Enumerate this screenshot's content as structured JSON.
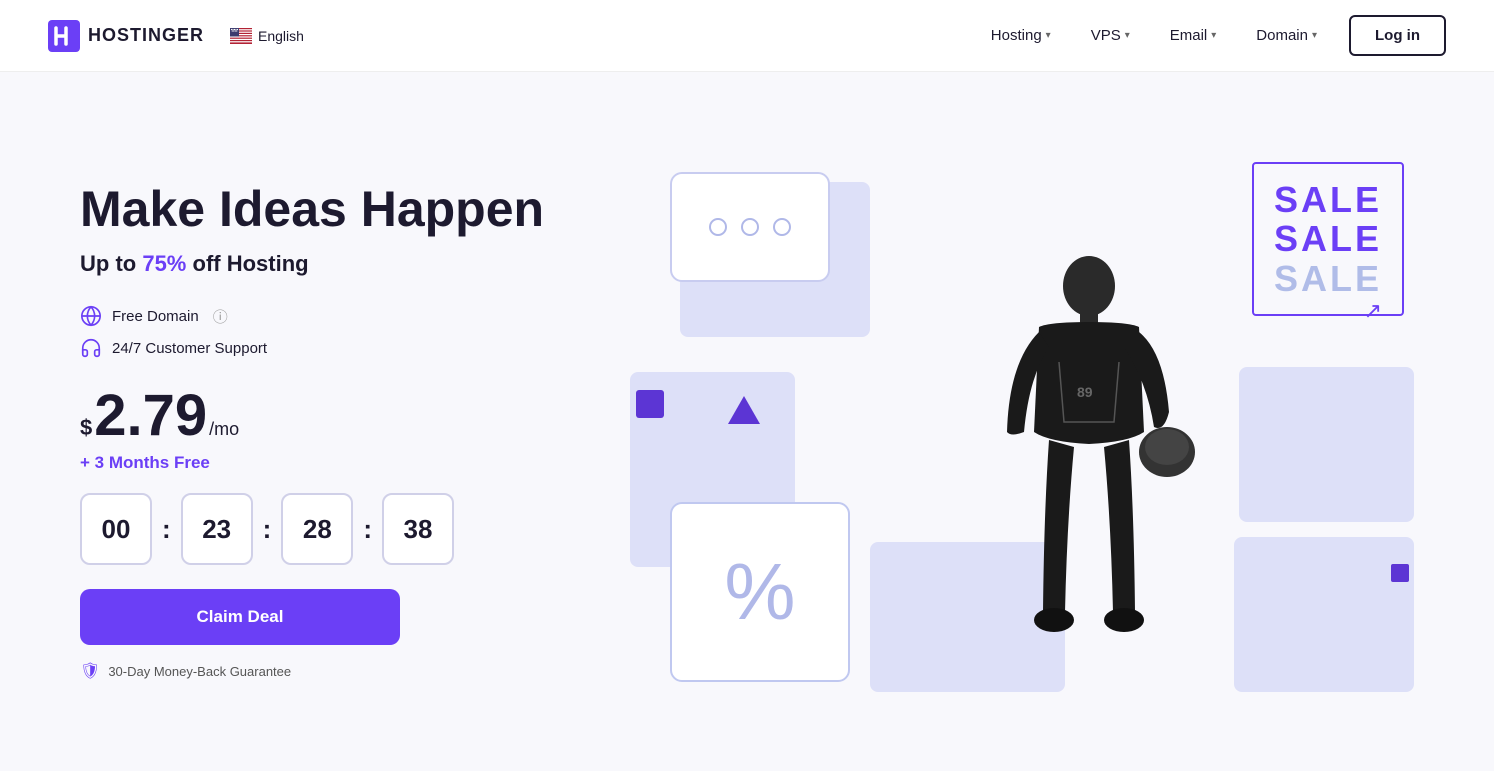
{
  "brand": {
    "name": "HOSTINGER",
    "logo_letter": "H"
  },
  "language": {
    "label": "English",
    "flag_emoji": "🇺🇸"
  },
  "nav": {
    "items": [
      {
        "label": "Hosting",
        "has_dropdown": true
      },
      {
        "label": "VPS",
        "has_dropdown": true
      },
      {
        "label": "Email",
        "has_dropdown": true
      },
      {
        "label": "Domain",
        "has_dropdown": true
      }
    ],
    "login_label": "Log in"
  },
  "hero": {
    "headline": "Make Ideas Happen",
    "subheadline_prefix": "Up to ",
    "discount": "75%",
    "subheadline_suffix": " off Hosting",
    "feature_domain": "Free Domain",
    "feature_support": "24/7 Customer Support",
    "price_dollar": "$",
    "price_main": "2.79",
    "price_mo": "/mo",
    "free_months": "+ 3 Months Free",
    "countdown": {
      "hours": "00",
      "minutes": "23",
      "seconds": "28",
      "centiseconds": "38"
    },
    "cta_label": "Claim Deal",
    "guarantee": "30-Day Money-Back Guarantee"
  },
  "sale": {
    "line1": "SALE",
    "line2": "SALE",
    "line3": "SALE"
  },
  "colors": {
    "purple": "#6b3ff6",
    "dark": "#1d1a2f",
    "light_purple": "#dde0f8"
  }
}
